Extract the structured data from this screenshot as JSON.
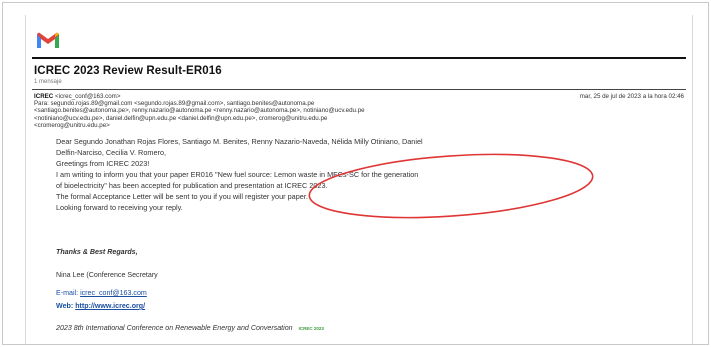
{
  "colors": {
    "accent_red": "#e0453a",
    "link_blue": "#1a4fa0",
    "annotation_red": "#e03535"
  },
  "email": {
    "subject": "ICREC 2023 Review Result-ER016",
    "message_count": "1 mensaje",
    "sender_name": "ICREC",
    "sender_email": "<icrec_conf@163.com>",
    "date": "mar, 25 de jul de 2023 a la hora 02:46",
    "recipients": [
      "Para: segundo.rojas.89@gmail.com <segundo.rojas.89@gmail.com>, santiago.benites@autonoma.pe",
      "<santiago.benites@autonoma.pe>, renny.nazario@autonoma.pe <renny.nazario@autonoma.pe>, notiniano@ucv.edu.pe",
      "<notiniano@ucv.edu.pe>, daniel.delfin@upn.edu.pe <daniel.delfin@upn.edu.pe>, cromerog@unitru.edu.pe",
      "<cromerog@unitru.edu.pe>"
    ],
    "body_lines": [
      "Dear Segundo Jonathan Rojas Flores, Santiago M. Benites, Renny Nazario-Naveda, Nélida Milly Otiniano, Daniel",
      "Delfin-Narciso, Cecilia V. Romero,",
      "Greetings from ICREC 2023!",
      "I am writing to inform you that your paper ER016 \"New fuel source: Lemon waste in MFCs-SC for the generation",
      "of bioelectricity\" has been accepted for publication and presentation at ICREC 2023.",
      "The formal Acceptance Letter will be sent to you if you will register your paper.",
      "Looking forward to receiving your reply."
    ],
    "closing": "Thanks & Best Regards,",
    "signer": "Nina Lee (Conference Secretary",
    "email_label": "E-mail:",
    "email_value": "icrec_conf@163.com",
    "web_label": "Web:",
    "web_value": "http://www.icrec.org/",
    "conference": "2023 8th International Conference on Renewable Energy and Conversation",
    "small_logo_text": "ICREC 2023"
  }
}
